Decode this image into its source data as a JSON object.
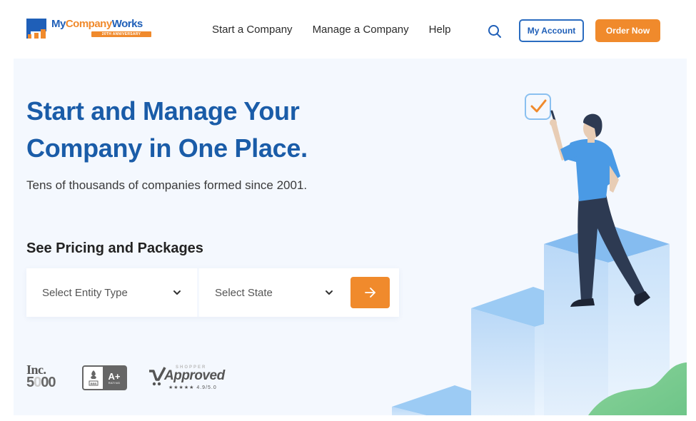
{
  "header": {
    "logo": {
      "name_part1": "My",
      "name_part2": "Company",
      "name_part3": "Works",
      "anniversary_badge": "20TH ANNIVERSARY",
      "icon": "bar-chart-logo-icon"
    },
    "nav": [
      {
        "label": "Start a Company"
      },
      {
        "label": "Manage a Company"
      },
      {
        "label": "Help"
      }
    ],
    "search_icon": "search-icon",
    "my_account_label": "My Account",
    "order_now_label": "Order Now"
  },
  "hero": {
    "title_line1": "Start and Manage Your",
    "title_line2": "Company in One Place.",
    "subtitle": "Tens of thousands of companies formed since 2001.",
    "pricing_heading": "See Pricing and Packages",
    "selector": {
      "entity_placeholder": "Select Entity Type",
      "state_placeholder": "Select State",
      "go_icon": "arrow-right-icon"
    },
    "badges": {
      "inc_top": "Inc.",
      "inc_bottom_a": "5",
      "inc_bottom_b": "0",
      "inc_bottom_c": "00",
      "bbb_label": "BBB",
      "bbb_grade": "A+",
      "bbb_rating": "RATING",
      "shopper_small": "SHOPPER",
      "shopper_approved": "Approved",
      "shopper_stars": "★★★★★",
      "shopper_score": "4.9/5.0"
    }
  },
  "colors": {
    "brand_blue": "#1a5ca8",
    "brand_orange": "#f08a2c",
    "hero_bg": "#f4f8fe"
  }
}
